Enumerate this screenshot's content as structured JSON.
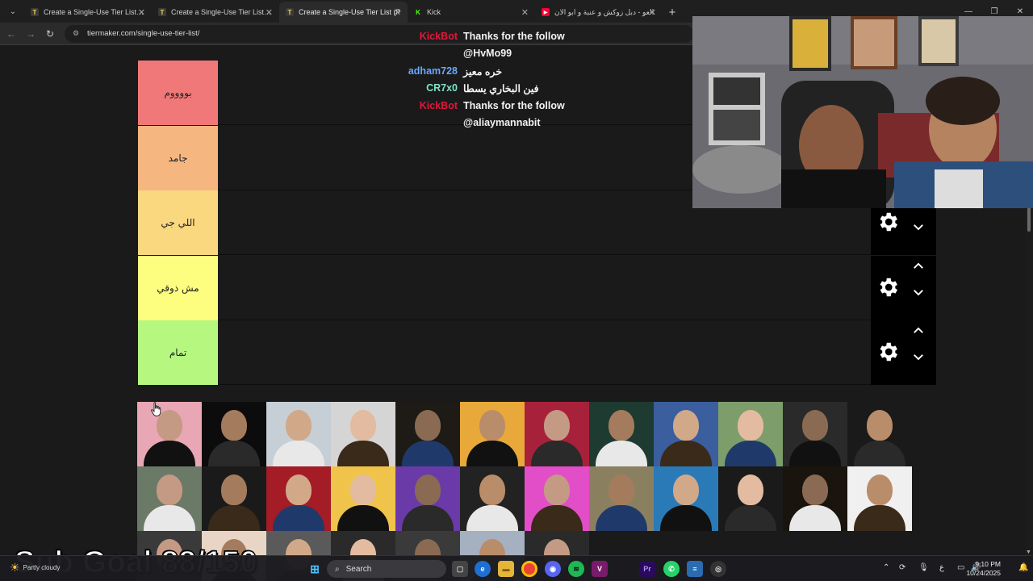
{
  "browser": {
    "tabs": [
      {
        "label": "Create a Single-Use Tier List (P",
        "icon": "tiermaker-favicon",
        "active": false
      },
      {
        "label": "Create a Single-Use Tier List (P",
        "icon": "tiermaker-favicon",
        "active": false
      },
      {
        "label": "Create a Single-Use Tier List (P",
        "icon": "tiermaker-favicon",
        "active": true
      },
      {
        "label": "Kick",
        "icon": "kick-favicon",
        "active": false
      },
      {
        "label": "العو - دبل زوكش و عنبة و ابو الان",
        "icon": "youtube-favicon",
        "active": false
      }
    ],
    "url": "tiermaker.com/single-use-tier-list/"
  },
  "tiers": [
    {
      "label": "بووووم",
      "color": "#f07878"
    },
    {
      "label": "جامد",
      "color": "#f6b67f"
    },
    {
      "label": "اللي جي",
      "color": "#f9d880"
    },
    {
      "label": "مش ذوقي",
      "color": "#fdfd80"
    },
    {
      "label": "تمام",
      "color": "#b6f87f"
    }
  ],
  "chat": [
    {
      "user": "KickBot",
      "user_color": "#e8143c",
      "message": "Thanks for the follow"
    },
    {
      "user": "",
      "user_color": "#e8143c",
      "message": "@HvMo99"
    },
    {
      "user": "adham728",
      "user_color": "#6aa7ff",
      "message": "خره معيز"
    },
    {
      "user": "CR7x0",
      "user_color": "#7fe3c8",
      "message": "فين البخاري يسطا"
    },
    {
      "user": "KickBot",
      "user_color": "#e8143c",
      "message": "Thanks for the follow"
    },
    {
      "user": "",
      "user_color": "#e8143c",
      "message": "@aliaymannabit"
    }
  ],
  "overlay": {
    "sub_goal": "Sub Goal 88/150",
    "sub_goal_current": 88,
    "sub_goal_target": 150
  },
  "taskbar": {
    "search_label": "Search",
    "time": "9:10 PM",
    "date": "10/24/2025",
    "language": "ع",
    "weather_text": "Partly cloudy"
  }
}
